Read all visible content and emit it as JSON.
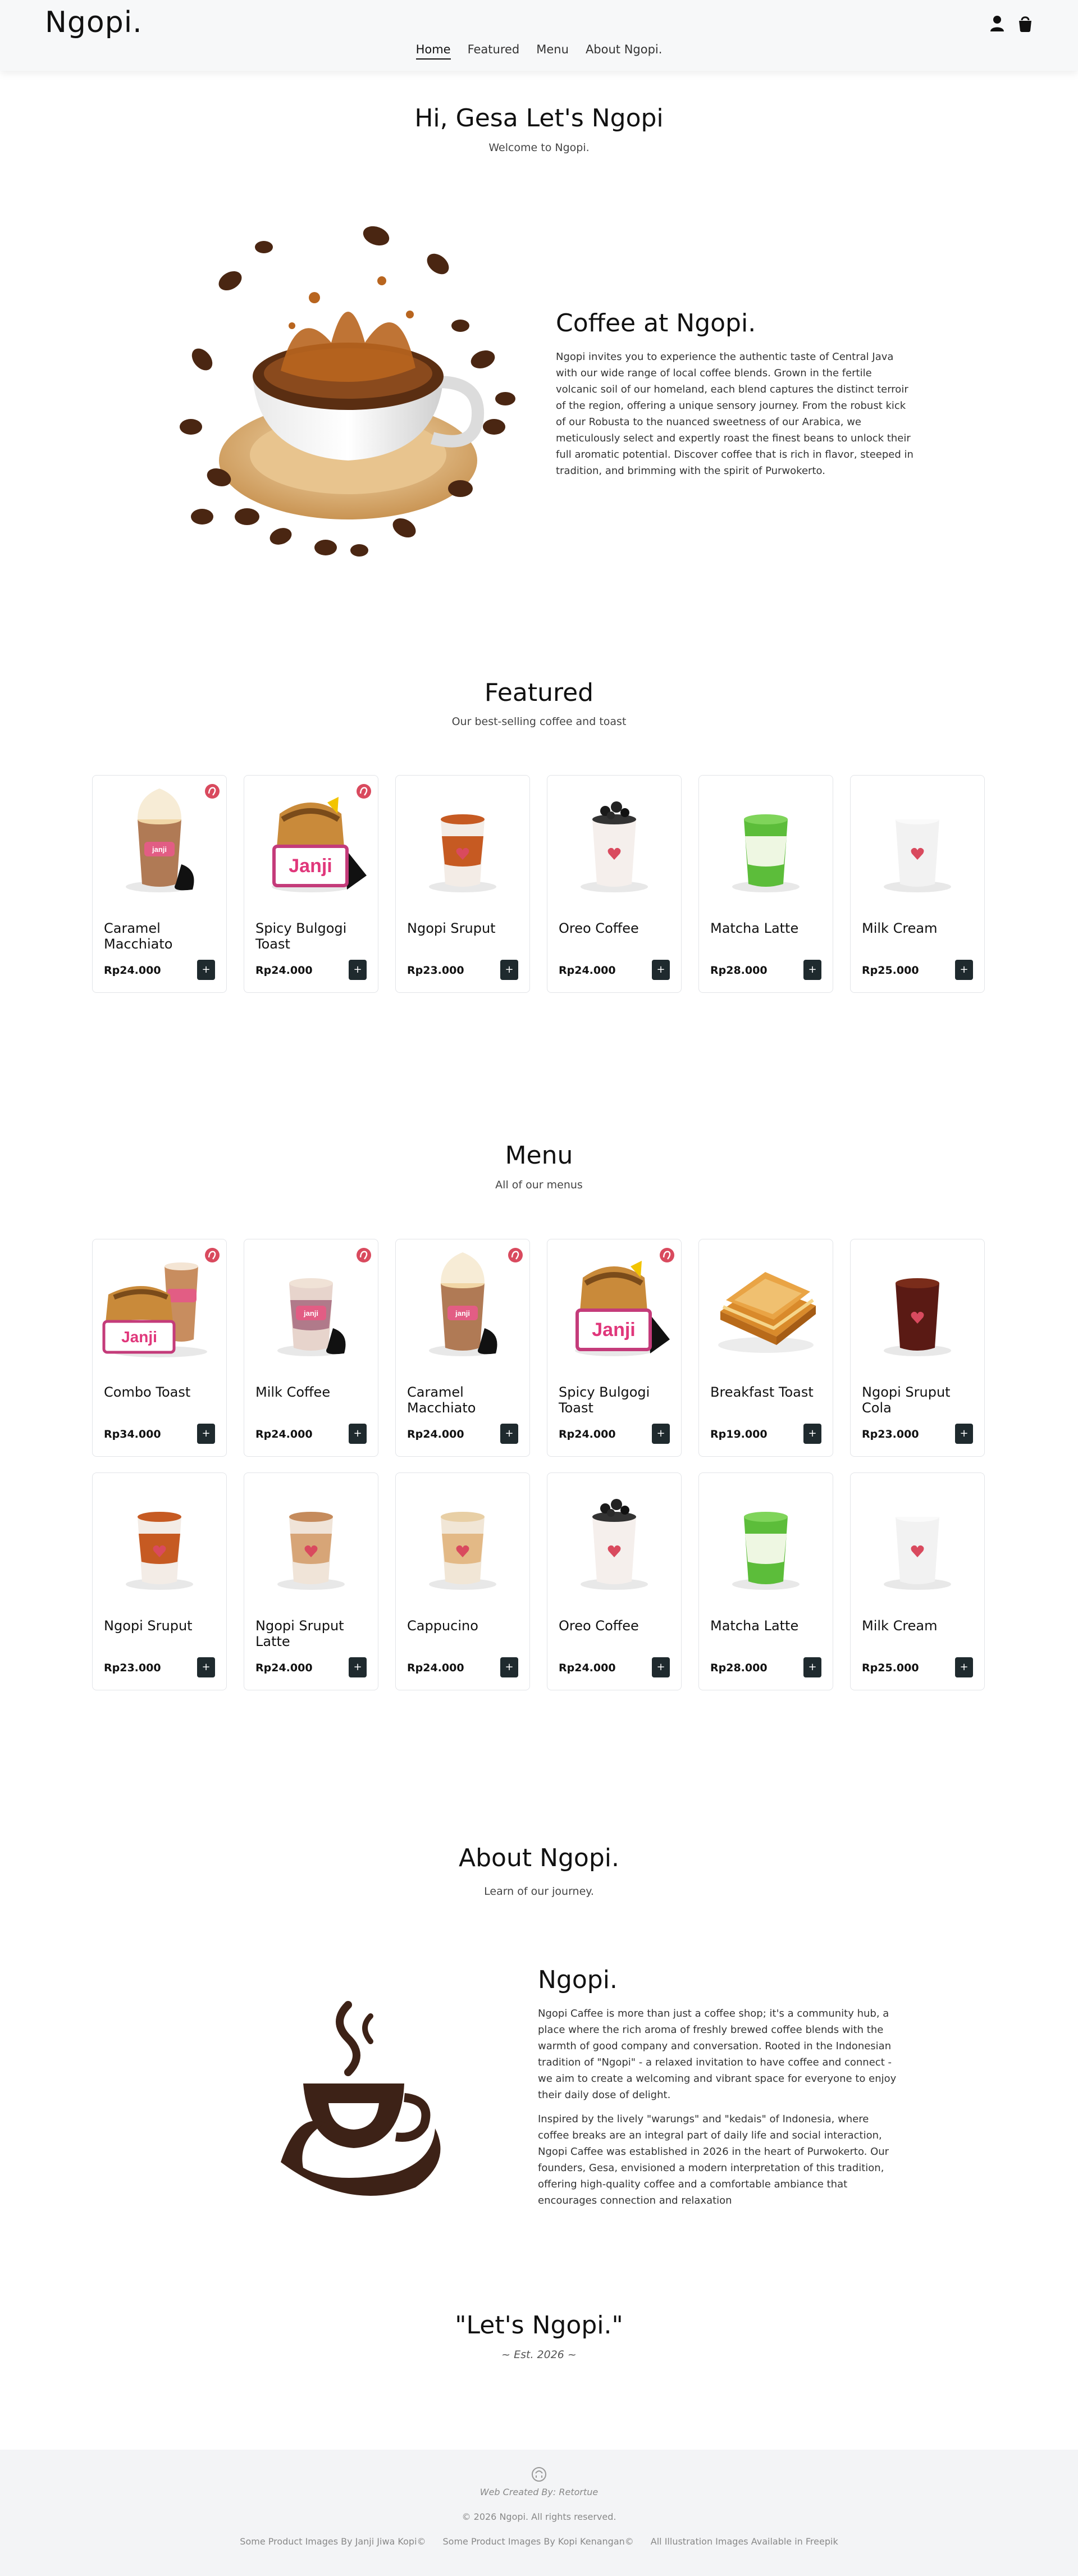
{
  "brand": "Ngopi.",
  "nav": [
    "Home",
    "Featured",
    "Menu",
    "About Ngopi."
  ],
  "header_icons": [
    "user-icon",
    "cart-icon"
  ],
  "greeting": {
    "title": "Hi, Gesa Let's Ngopi",
    "subtitle": "Welcome to Ngopi."
  },
  "hero": {
    "title": "Coffee at Ngopi.",
    "body": "Ngopi invites you to experience the authentic taste of Central Java with our wide range of local coffee blends. Grown in the fertile volcanic soil of our homeland, each blend captures the distinct terroir of the region, offering a unique sensory journey. From the robust kick of our Robusta to the nuanced sweetness of our Arabica, we meticulously select and expertly roast the finest beans to unlock their full aromatic potential. Discover coffee that is rich in flavor, steeped in tradition, and brimming with the spirit of Purwokerto."
  },
  "featured": {
    "title": "Featured",
    "subtitle": "Our best-selling coffee and toast",
    "items": [
      {
        "name": "Caramel Macchiato",
        "price": "Rp24.000",
        "kind": "caramel",
        "badge": true
      },
      {
        "name": "Spicy Bulgogi Toast",
        "price": "Rp24.000",
        "kind": "toastpack",
        "badge": true
      },
      {
        "name": "Ngopi Sruput",
        "price": "Rp23.000",
        "kind": "sruput",
        "badge": false
      },
      {
        "name": "Oreo Coffee",
        "price": "Rp24.000",
        "kind": "oreo",
        "badge": false
      },
      {
        "name": "Matcha Latte",
        "price": "Rp28.000",
        "kind": "matcha",
        "badge": false
      },
      {
        "name": "Milk Cream",
        "price": "Rp25.000",
        "kind": "cream",
        "badge": false
      }
    ]
  },
  "menu": {
    "title": "Menu",
    "subtitle": "All of our menus",
    "items": [
      {
        "name": "Combo Toast",
        "price": "Rp34.000",
        "kind": "combo",
        "badge": true
      },
      {
        "name": "Milk Coffee",
        "price": "Rp24.000",
        "kind": "milkcoffee",
        "badge": true
      },
      {
        "name": "Caramel Macchiato",
        "price": "Rp24.000",
        "kind": "caramel",
        "badge": true
      },
      {
        "name": "Spicy Bulgogi Toast",
        "price": "Rp24.000",
        "kind": "toastpack",
        "badge": true
      },
      {
        "name": "Breakfast Toast",
        "price": "Rp19.000",
        "kind": "breakfast",
        "badge": false
      },
      {
        "name": "Ngopi Sruput Cola",
        "price": "Rp23.000",
        "kind": "cola",
        "badge": false
      },
      {
        "name": "Ngopi Sruput",
        "price": "Rp23.000",
        "kind": "sruput",
        "badge": false
      },
      {
        "name": "Ngopi Sruput Latte",
        "price": "Rp24.000",
        "kind": "latte",
        "badge": false
      },
      {
        "name": "Cappucino",
        "price": "Rp24.000",
        "kind": "cappucino",
        "badge": false
      },
      {
        "name": "Oreo Coffee",
        "price": "Rp24.000",
        "kind": "oreo",
        "badge": false
      },
      {
        "name": "Matcha Latte",
        "price": "Rp28.000",
        "kind": "matcha",
        "badge": false
      },
      {
        "name": "Milk Cream",
        "price": "Rp25.000",
        "kind": "cream",
        "badge": false
      }
    ]
  },
  "add_button_label": "+",
  "about": {
    "title": "About Ngopi.",
    "subtitle": "Learn of our journey.",
    "heading": "Ngopi.",
    "p1": "Ngopi Caffee is more than just a coffee shop; it's a community hub, a place where the rich aroma of freshly brewed coffee blends with the warmth of good company and conversation. Rooted in the Indonesian tradition of \"Ngopi\" - a relaxed invitation to have coffee and connect - we aim to create a welcoming and vibrant space for everyone to enjoy their daily dose of delight.",
    "p2": "Inspired by the lively \"warungs\" and \"kedais\" of Indonesia, where coffee breaks are an integral part of daily life and social interaction, Ngopi Caffee was established in 2026 in the heart of Purwokerto. Our founders, Gesa, envisioned a modern interpretation of this tradition, offering high-quality coffee and a comfortable ambiance that encourages connection and relaxation"
  },
  "quote": {
    "text": "\"Let's Ngopi.\"",
    "sub": "~ Est. 2026 ~"
  },
  "footer": {
    "created": "Web Created By: Retortue",
    "copyright": "© 2026 Ngopi. All rights reserved.",
    "credits": [
      "Some Product Images By Janji Jiwa Kopi©",
      "Some Product Images By Kopi Kenangan©",
      "All Illustration Images Available in Freepik"
    ]
  },
  "colors": {
    "accent": "#1f2a2e",
    "coffee_brown": "#3d2217",
    "badge_red": "#d94a5e",
    "footer_bg": "#f3f4f6"
  }
}
